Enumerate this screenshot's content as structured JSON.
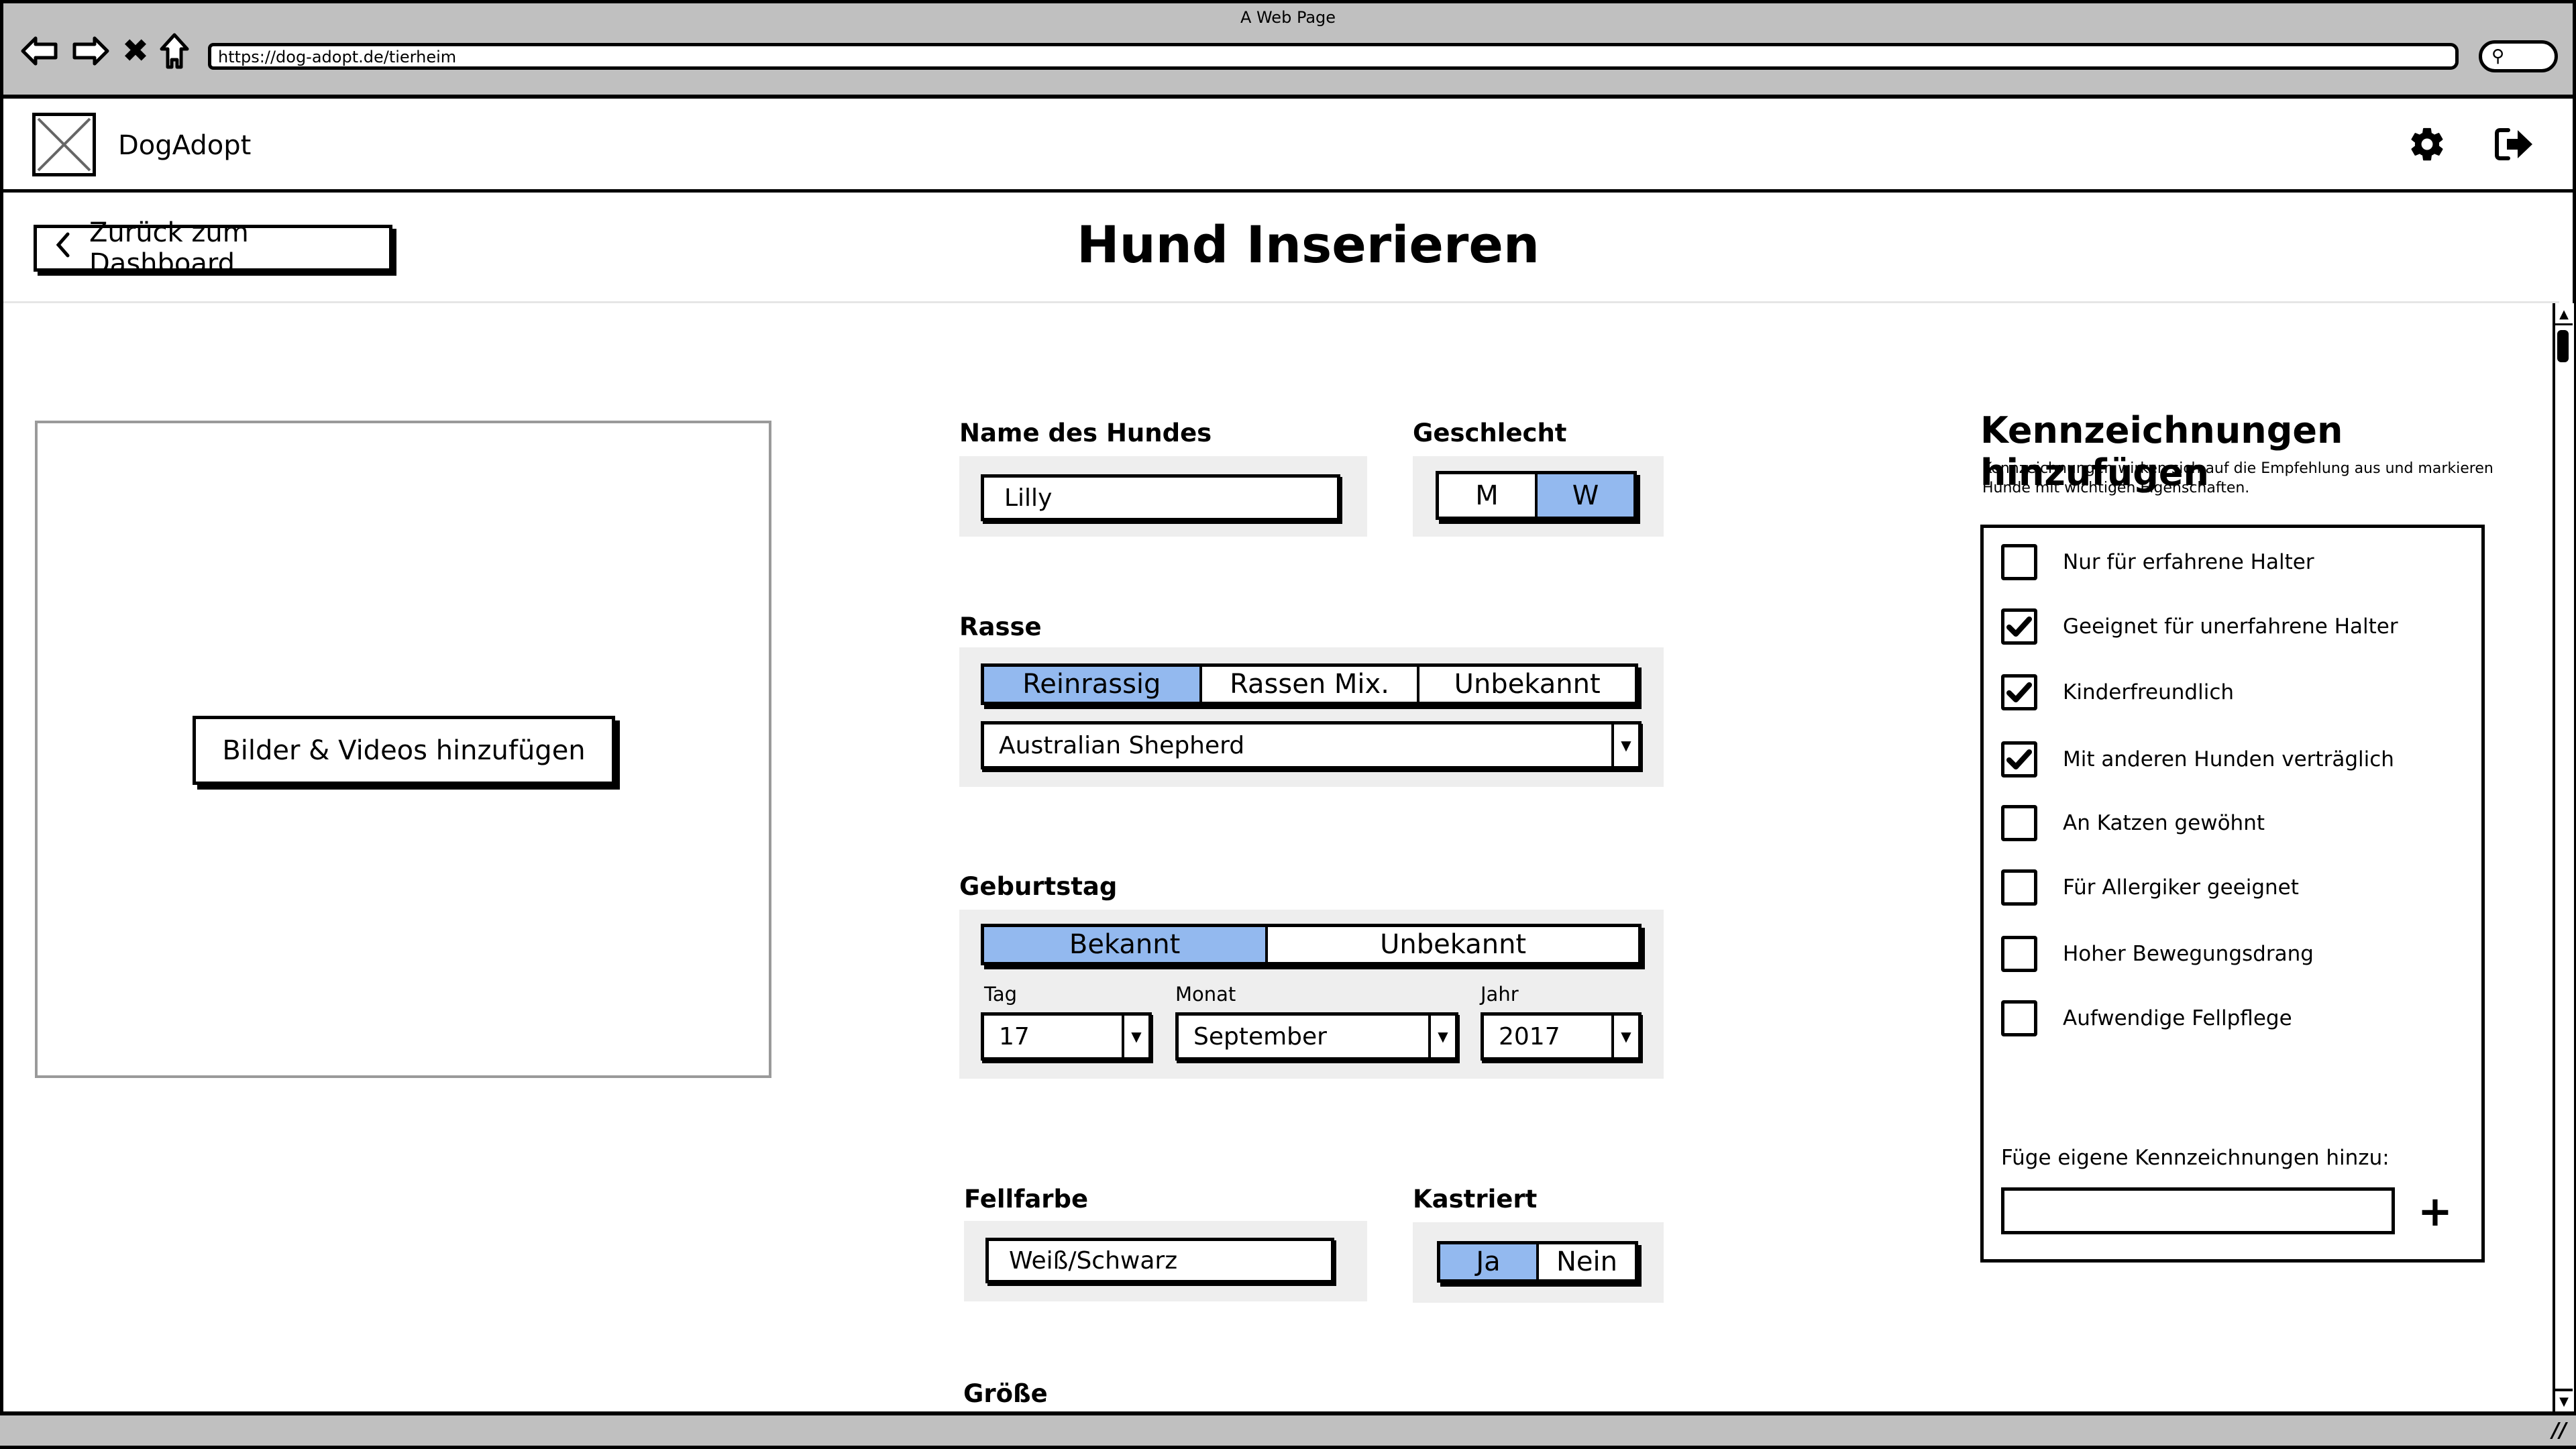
{
  "browser": {
    "window_title": "A Web Page",
    "url": "https://dog-adopt.de/tierheim",
    "icons": [
      "back-arrow-icon",
      "forward-arrow-icon",
      "stop-icon",
      "home-icon",
      "search-icon"
    ]
  },
  "header": {
    "brand": "DogAdopt",
    "icons": [
      "settings-gear-icon",
      "logout-icon"
    ]
  },
  "subheader": {
    "back_label": "Zurück zum Dashboard",
    "title": "Hund Inserieren"
  },
  "media": {
    "upload_label": "Bilder & Videos hinzufügen"
  },
  "form": {
    "name": {
      "label": "Name des Hundes",
      "value": "Lilly"
    },
    "gender": {
      "label": "Geschlecht",
      "options": [
        "M",
        "W"
      ],
      "selected": "W"
    },
    "breed": {
      "label": "Rasse",
      "options": [
        "Reinrassig",
        "Rassen Mix.",
        "Unbekannt"
      ],
      "selected": "Reinrassig",
      "select_value": "Australian Shepherd"
    },
    "birthday": {
      "label": "Geburtstag",
      "options": [
        "Bekannt",
        "Unbekannt"
      ],
      "selected": "Bekannt",
      "day_label": "Tag",
      "day_value": "17",
      "month_label": "Monat",
      "month_value": "September",
      "year_label": "Jahr",
      "year_value": "2017"
    },
    "fur_color": {
      "label": "Fellfarbe",
      "value": "Weiß/Schwarz"
    },
    "neutered": {
      "label": "Kastriert",
      "options": [
        "Ja",
        "Nein"
      ],
      "selected": "Ja"
    },
    "size": {
      "label": "Größe"
    }
  },
  "tags": {
    "title": "Kennzeichnungen hinzufügen",
    "description": "Kennzeichnungen wirken sich auf die Empfehlung aus und markieren Hunde mit wichtigen Eigenschaften.",
    "items": [
      {
        "label": "Nur für erfahrene Halter",
        "checked": false
      },
      {
        "label": "Geeignet für unerfahrene Halter",
        "checked": true
      },
      {
        "label": "Kinderfreundlich",
        "checked": true
      },
      {
        "label": "Mit anderen Hunden verträglich",
        "checked": true
      },
      {
        "label": "An Katzen gewöhnt",
        "checked": false
      },
      {
        "label": "Für Allergiker geeignet",
        "checked": false
      },
      {
        "label": "Hoher Bewegungsdrang",
        "checked": false
      },
      {
        "label": "Aufwendige Fellpflege",
        "checked": false
      }
    ],
    "custom_label": "Füge eigene Kennzeichnungen hinzu:",
    "custom_value": "",
    "add_icon": "plus-icon"
  },
  "colors": {
    "selected_toggle": "#93b9ef",
    "chrome_gray": "#c0c0c0",
    "field_group_bg": "#eeeeee"
  }
}
